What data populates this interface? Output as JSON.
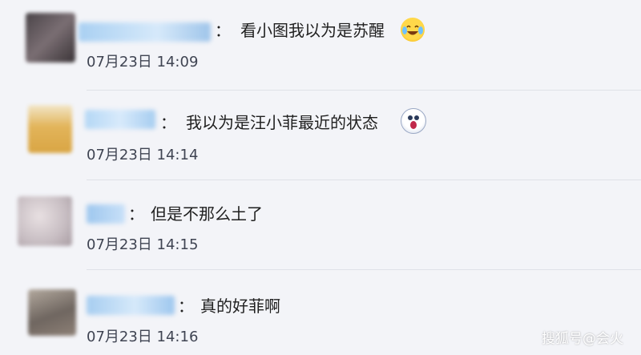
{
  "comments": [
    {
      "name": "",
      "text": "看小图我以为是苏醒",
      "time": "07月23日 14:09",
      "emoji": "crying-laughing-emoji"
    },
    {
      "name": "",
      "text": "我以为是汪小菲最近的状态",
      "time": "07月23日 14:14",
      "emoji": "screaming-ghost-emoji"
    },
    {
      "name": "",
      "text": "但是不那么土了",
      "time": "07月23日 14:15",
      "emoji": ""
    },
    {
      "name": "",
      "text": "真的好菲啊",
      "time": "07月23日 14:16",
      "emoji": ""
    }
  ],
  "colon": "：",
  "watermark": "搜狐号@会火",
  "colors": {
    "background": "#f3f4f8",
    "name_blue": "#9ec7ee",
    "divider": "#dfe1e8"
  }
}
